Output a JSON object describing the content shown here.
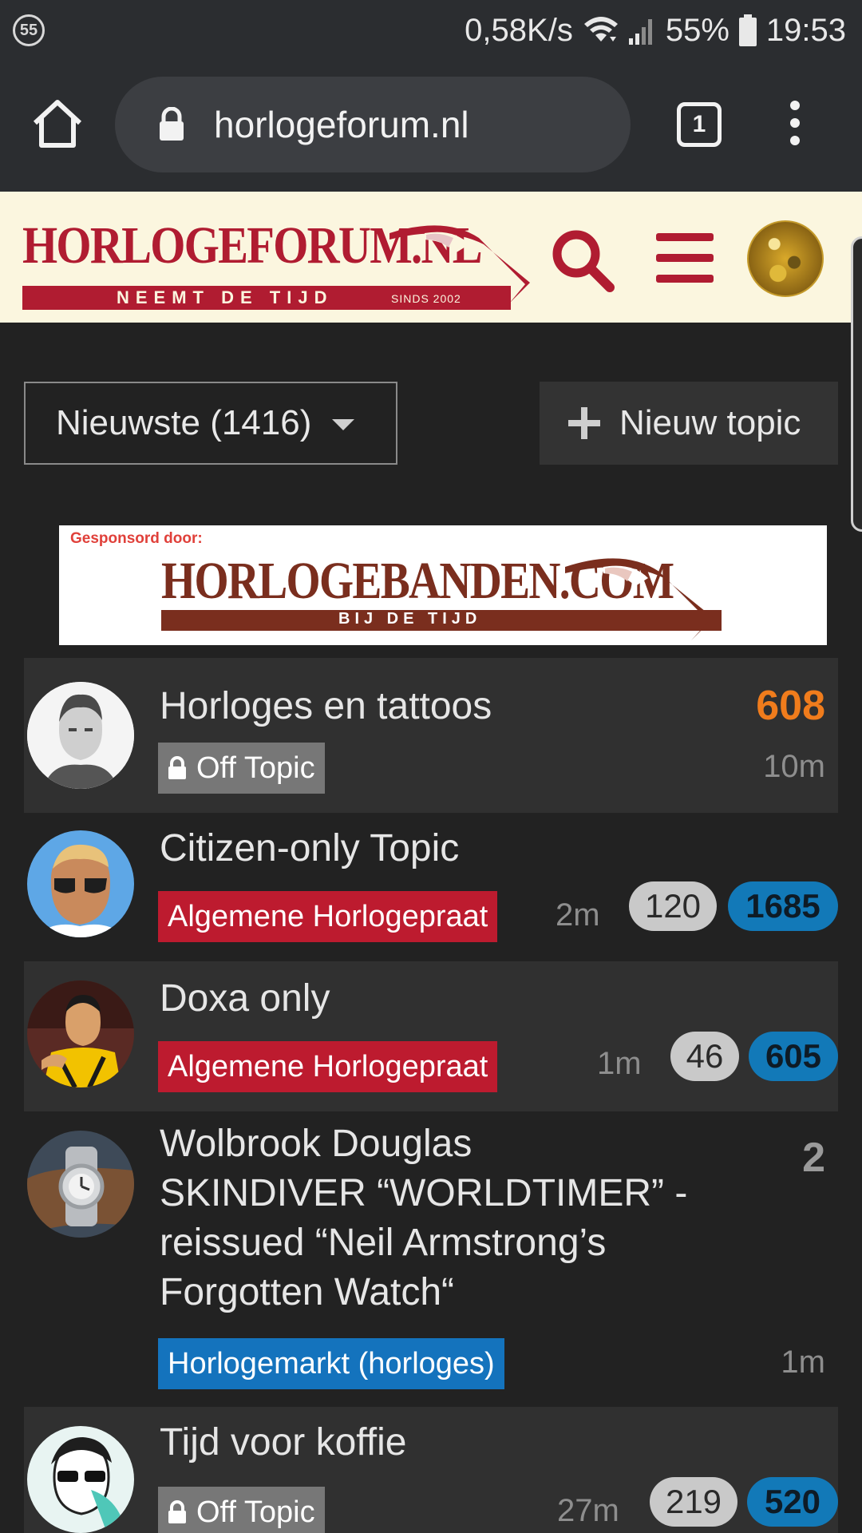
{
  "status_bar": {
    "notification_count": "55",
    "net_speed": "0,58K/s",
    "battery": "55%",
    "time": "19:53"
  },
  "browser": {
    "url": "horlogeforum.nl",
    "tab_count": "1"
  },
  "site": {
    "logo_text": "HORLOGEFORUM.NL",
    "logo_tagline": "NEEMT DE TIJD",
    "logo_since": "SINDS 2002",
    "brand_color": "#b01c31"
  },
  "controls": {
    "filter_label": "Nieuwste (1416)",
    "new_topic_label": "Nieuw topic"
  },
  "sponsor": {
    "label": "Gesponsord door:",
    "name": "HORLOGEBANDEN.COM",
    "tagline": "BIJ DE TIJD"
  },
  "topics": [
    {
      "title": "Horloges en tattoos",
      "category": "Off Topic",
      "category_locked": true,
      "age": "10m",
      "new_posts": "608",
      "new_posts_color": "#f07c1c"
    },
    {
      "title": "Citizen-only Topic",
      "category": "Algemene Horlogepraat",
      "age": "2m",
      "unread": "120",
      "new_posts": "1685"
    },
    {
      "title": "Doxa only",
      "category": "Algemene Horlogepraat",
      "age": "1m",
      "unread": "46",
      "new_posts": "605"
    },
    {
      "title_lines": [
        "Wolbrook Douglas",
        "SKINDIVER “WORLDTIMER” -",
        "reissued “Neil Armstrong’s",
        "Forgotten Watch“"
      ],
      "category": "Horlogemarkt (horloges)",
      "age": "1m",
      "new_posts": "2"
    },
    {
      "title": "Tijd voor koffie",
      "category": "Off Topic",
      "category_locked": true,
      "age": "27m",
      "unread": "219",
      "new_posts": "520"
    }
  ]
}
